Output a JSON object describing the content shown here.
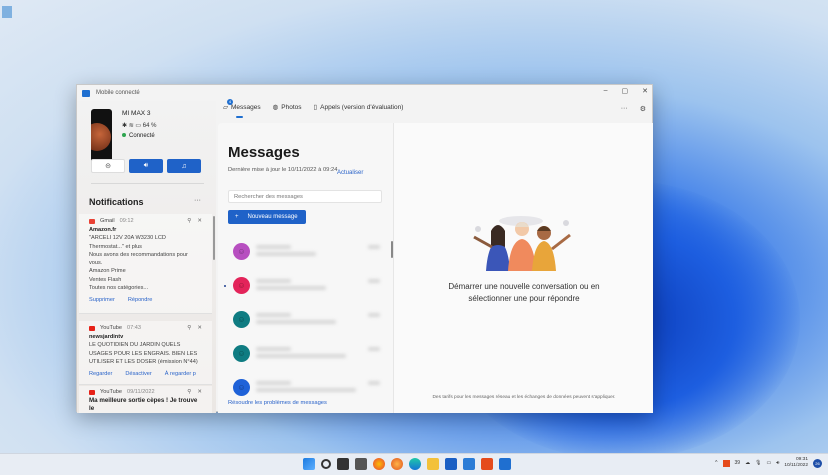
{
  "window": {
    "title": "Mobile connecté"
  },
  "device": {
    "name": "MI MAX 3",
    "battery": "64 %",
    "status": "Connecté"
  },
  "notifications": {
    "title": "Notifications",
    "more": "···",
    "items": [
      {
        "app": "Gmail",
        "time": "09:12",
        "sender": "Amazon.fr",
        "lines": [
          "\"ARCELI 12V 20A W3230 LCD",
          "Thermostat...\" et plus",
          "Nous avons des recommandations pour",
          "vous.",
          "Amazon Prime",
          "Ventes Flash",
          "Toutes nos catégories..."
        ],
        "actions": [
          "Supprimer",
          "Répondre"
        ]
      },
      {
        "app": "YouTube",
        "time": "07:43",
        "sender": "newsjardintv",
        "lines": [
          "LE QUOTIDIEN DU JARDIN QUELS",
          "USAGES POUR LES ENGRAIS. BIEN LES",
          "UTILISER ET LES DOSER (émission N°44)"
        ],
        "actions": [
          "Regarder",
          "Désactiver",
          "À regarder p"
        ]
      },
      {
        "app": "YouTube",
        "time": "09/11/2022",
        "sender": "Ma meilleure sortie cèpes ! Je trouve le"
      }
    ]
  },
  "tabs": [
    {
      "label": "Messages",
      "badge": "4"
    },
    {
      "label": "Photos"
    },
    {
      "label": "Appels (version d'évaluation)"
    }
  ],
  "messages": {
    "title": "Messages",
    "updated": "Dernière mise à jour le 10/11/2022 à 09:24",
    "refresh": "Actualiser",
    "search_placeholder": "Rechercher des messages",
    "new_message": "Nouveau message",
    "fix": "Résoudre les problèmes de messages",
    "avatar_colors": [
      "#b74fc0",
      "#e3245a",
      "#0f7c82",
      "#0f7c82",
      "#1f62d8"
    ]
  },
  "detail": {
    "prompt": "Démarrer une nouvelle conversation ou en sélectionner une pour répondre",
    "fees": "Des tarifs pour les messages réseau et les échanges de données peuvent s'appliquer."
  },
  "taskbar": {
    "time": "09:31",
    "date": "10/11/2022",
    "badge": "39",
    "notif": "26"
  }
}
